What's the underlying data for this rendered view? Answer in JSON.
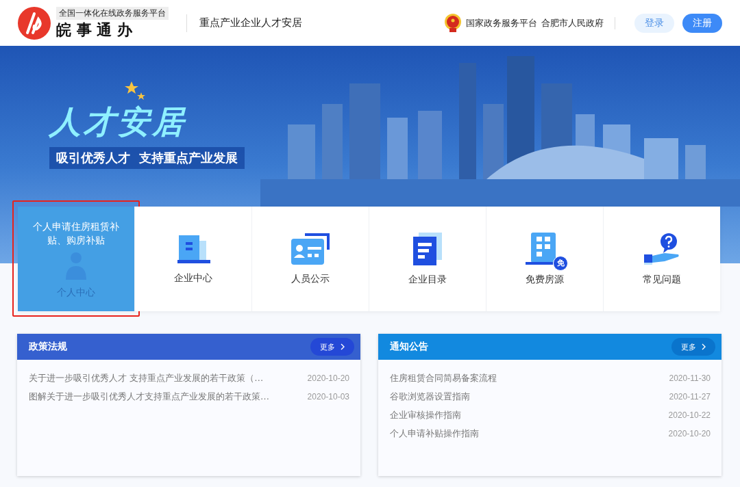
{
  "header": {
    "logo_tagline": "全国一体化在线政务服务平台",
    "logo_name": "皖 事 通 办",
    "site_title": "重点产业企业人才安居",
    "gov_links": [
      "国家政务服务平台",
      "合肥市人民政府"
    ],
    "buttons": [
      {
        "label": "登录",
        "kind": "light"
      },
      {
        "label": "注册",
        "kind": "primary"
      }
    ]
  },
  "banner": {
    "title": "人才安居",
    "slogan": "吸引优秀人才  支持重点产业发展"
  },
  "tiles": [
    {
      "label": "个人中心",
      "hovered": true,
      "highlighted": true,
      "description": "个人申请住房租赁补贴、购房补贴"
    },
    {
      "label": "企业中心",
      "hovered": false,
      "highlighted": false
    },
    {
      "label": "人员公示",
      "hovered": false,
      "highlighted": false
    },
    {
      "label": "企业目录",
      "hovered": false,
      "highlighted": false
    },
    {
      "label": "免费房源",
      "hovered": false,
      "highlighted": false,
      "badge": "免"
    },
    {
      "label": "常见问题",
      "hovered": false,
      "highlighted": false
    }
  ],
  "panels": [
    {
      "title": "政策法规",
      "more": "更多",
      "items": [
        {
          "title": "关于进一步吸引优秀人才 支持重点产业发展的若干政策（…",
          "date": "2020-10-20"
        },
        {
          "title": "图解关于进一步吸引优秀人才支持重点产业发展的若干政策…",
          "date": "2020-10-03"
        }
      ]
    },
    {
      "title": "通知公告",
      "more": "更多",
      "items": [
        {
          "title": "住房租赁合同简易备案流程",
          "date": "2020-11-30"
        },
        {
          "title": "谷歌浏览器设置指南",
          "date": "2020-11-27"
        },
        {
          "title": "企业审核操作指南",
          "date": "2020-10-22"
        },
        {
          "title": "个人申请补贴操作指南",
          "date": "2020-10-20"
        }
      ]
    }
  ]
}
